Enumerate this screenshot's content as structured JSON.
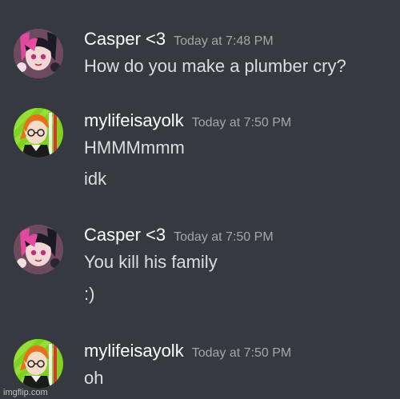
{
  "messages": [
    {
      "author": "Casper <3",
      "time": "Today at 7:48 PM",
      "avatar_icon": "anime-avatar-pink-icon",
      "lines": [
        "How do you make a plumber cry?"
      ]
    },
    {
      "author": "mylifeisayolk",
      "time": "Today at 7:50 PM",
      "avatar_icon": "anime-avatar-green-icon",
      "lines": [
        "HMMMmmm",
        "idk"
      ]
    },
    {
      "author": "Casper <3",
      "time": "Today at 7:50 PM",
      "avatar_icon": "anime-avatar-pink-icon",
      "lines": [
        "You kill his family",
        ":)"
      ]
    },
    {
      "author": "mylifeisayolk",
      "time": "Today at 7:50 PM",
      "avatar_icon": "anime-avatar-green-icon",
      "lines": [
        "oh"
      ]
    }
  ],
  "watermark": "imgflip.com",
  "colors": {
    "background": "#36393f",
    "username": "#ffffff",
    "timestamp": "#a3a6aa",
    "message_text": "#dcddde"
  }
}
